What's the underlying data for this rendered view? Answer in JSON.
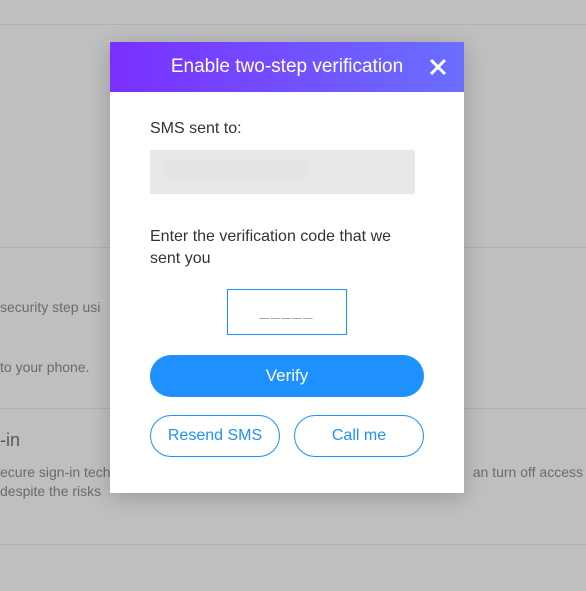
{
  "background": {
    "text1": "security step usi",
    "text2": "to your phone.",
    "heading": "-in",
    "text3": "ecure sign-in tech",
    "text4": "despite the risks",
    "text5": "an turn off access"
  },
  "modal": {
    "title": "Enable two-step verification",
    "sms_label": "SMS sent to:",
    "enter_code_label": "Enter the verification code that we sent you",
    "code_placeholder": "_____",
    "verify_label": "Verify",
    "resend_label": "Resend SMS",
    "call_label": "Call me"
  }
}
